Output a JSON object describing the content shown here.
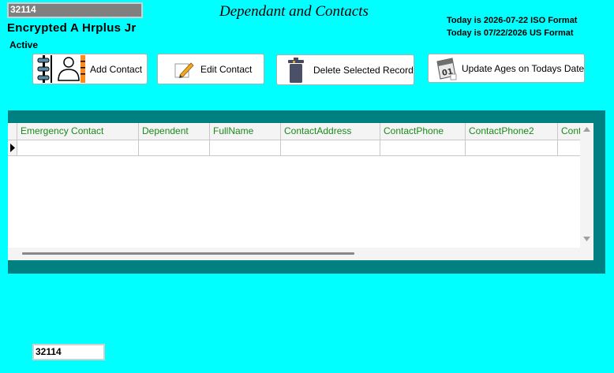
{
  "header": {
    "record_id": "32114",
    "employee_name": "Encrypted A Hrplus Jr",
    "status": "Active",
    "title": "Dependant and Contacts",
    "date_iso": "Today is 2026-07-22 ISO Format",
    "date_us": "Today is 07/22/2026 US Format"
  },
  "toolbar": {
    "add_label": "Add Contact",
    "edit_label": "Edit Contact",
    "delete_label": "Delete Selected Record",
    "update_label": "Update Ages on Todays Date"
  },
  "grid": {
    "columns": [
      "Emergency Contact",
      "Dependent",
      "FullName",
      "ContactAddress",
      "ContactPhone",
      "ContactPhone2",
      "Cont"
    ]
  },
  "footer": {
    "record_id": "32114"
  },
  "colors": {
    "background": "#00ffff",
    "panel": "#008080",
    "header_text": "#1a8a1a"
  }
}
